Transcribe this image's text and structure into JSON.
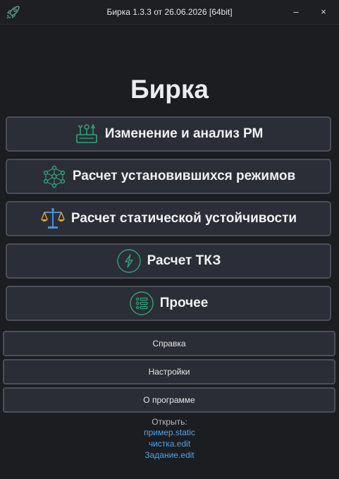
{
  "window": {
    "title": "Бирка 1.3.3 от 26.06.2026 [64bit]",
    "minimize_label": "–",
    "close_label": "×",
    "app_icon": "rocket-icon"
  },
  "app_name": "Бирка",
  "main_buttons": [
    {
      "label": "Изменение и анализ РМ",
      "icon": "tools-icon"
    },
    {
      "label": "Расчет установившихся режимов",
      "icon": "network-graph-icon"
    },
    {
      "label": "Расчет статической устойчивости",
      "icon": "balance-scale-icon"
    },
    {
      "label": "Расчет ТКЗ",
      "icon": "lightning-icon"
    },
    {
      "label": "Прочее",
      "icon": "list-icon"
    }
  ],
  "secondary_buttons": [
    {
      "label": "Справка"
    },
    {
      "label": "Настройки"
    },
    {
      "label": "О программе"
    }
  ],
  "recent": {
    "label": "Открыть:",
    "files": [
      "пример.static",
      "чистка.edit",
      "Задание.edit"
    ]
  },
  "colors": {
    "background": "#1c1d21",
    "button_bg": "#2b2e36",
    "button_border": "#4a4f5a",
    "link": "#4ea4ea",
    "icon_green": "#2fa37a"
  }
}
